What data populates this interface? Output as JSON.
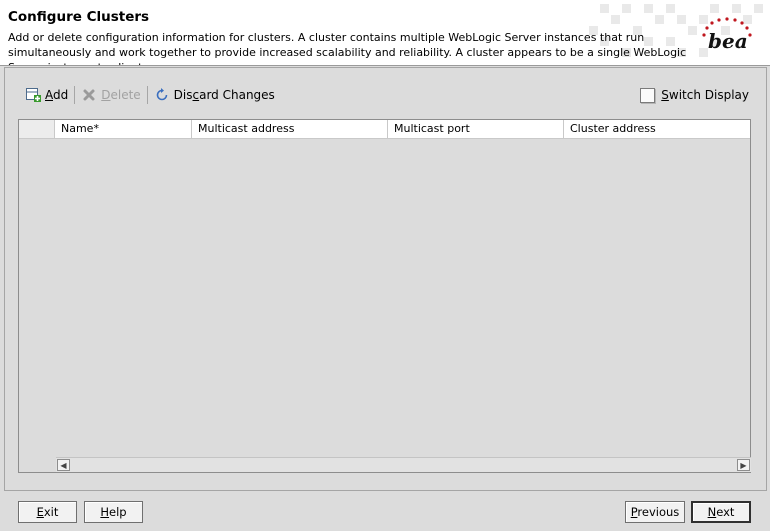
{
  "header": {
    "title": "Configure Clusters",
    "description": "Add or delete configuration information for clusters. A cluster contains multiple WebLogic Server instances that run simultaneously and work together to provide increased scalability and reliability. A cluster appears to be a single WebLogic Server instance to clients.",
    "logo_text": "bea"
  },
  "toolbar": {
    "add": {
      "mnemonic": "A",
      "rest": "dd",
      "icon": "add-row-icon"
    },
    "delete": {
      "mnemonic": "D",
      "rest": "elete",
      "icon": "delete-x-icon"
    },
    "discard": {
      "pre": "Dis",
      "mnemonic": "c",
      "rest": "ard Changes",
      "icon": "refresh-icon"
    },
    "switch_display": {
      "mnemonic": "S",
      "rest": "witch Display"
    }
  },
  "table": {
    "columns": [
      "Name*",
      "Multicast address",
      "Multicast port",
      "Cluster address"
    ],
    "rows": []
  },
  "footer": {
    "exit": {
      "mnemonic": "E",
      "rest": "xit"
    },
    "help": {
      "mnemonic": "H",
      "rest": "elp"
    },
    "previous": {
      "mnemonic": "P",
      "rest": "revious"
    },
    "next": {
      "mnemonic": "N",
      "rest": "ext"
    }
  },
  "colors": {
    "accent_red": "#c0171f",
    "border": "#8d8d8d",
    "panel": "#dcdcdc"
  }
}
